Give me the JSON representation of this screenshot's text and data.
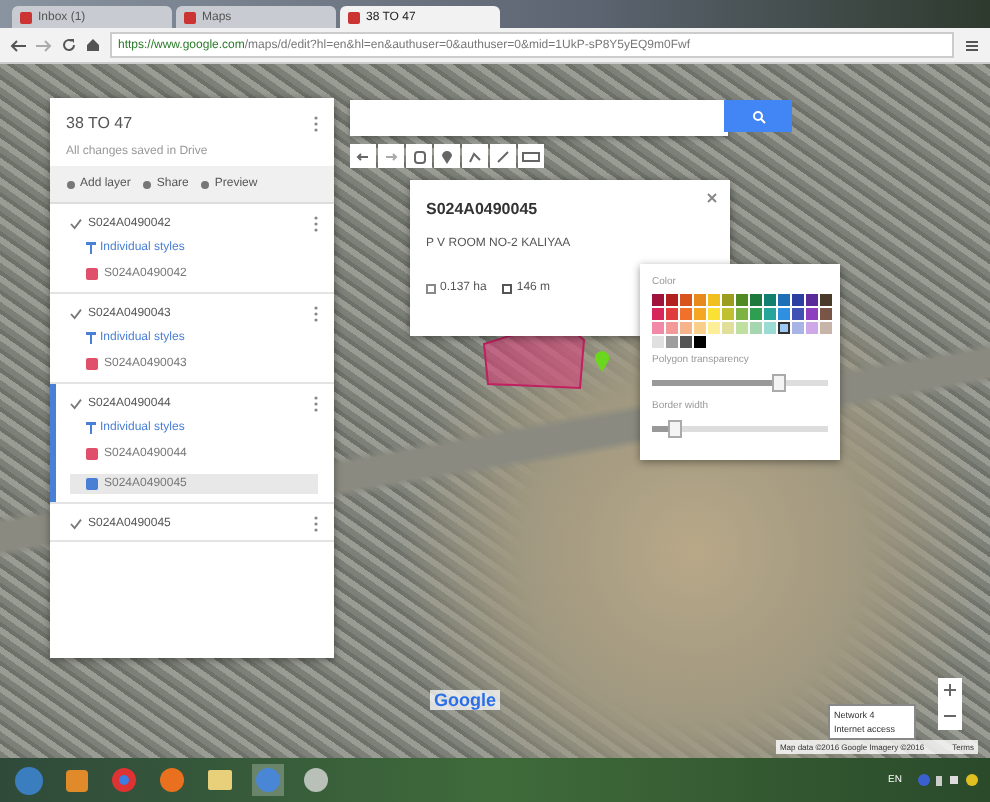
{
  "browser": {
    "tabs": [
      {
        "label": "Inbox (1)",
        "selected": false
      },
      {
        "label": "Maps",
        "selected": false
      },
      {
        "label": "38 TO 47",
        "selected": true
      }
    ],
    "url_host": "https://www.google.com",
    "url_path": "/maps/d/edit?hl=en&hl=en&authuser=0&authuser=0&mid=1UkP-sP8Y5yEQ9m0Fwf"
  },
  "map_panel": {
    "title": "38 TO 47",
    "status": "All changes saved in Drive",
    "actions": [
      "Add layer",
      "Share",
      "Preview"
    ],
    "layers": [
      {
        "name": "S024A0490042",
        "checked": true,
        "selected": false,
        "style": "Individual styles",
        "features": [
          {
            "name": "S024A0490042",
            "color": "#e0506a",
            "selected": false
          }
        ]
      },
      {
        "name": "S024A0490043",
        "checked": true,
        "selected": false,
        "style": "Individual styles",
        "features": [
          {
            "name": "S024A0490043",
            "color": "#e0506a",
            "selected": false
          }
        ]
      },
      {
        "name": "S024A0490044",
        "checked": true,
        "selected": true,
        "style": "Individual styles",
        "features": [
          {
            "name": "S024A0490044",
            "color": "#e0506a",
            "selected": false
          },
          {
            "name": "S024A0490045",
            "color": "#4a7fd6",
            "selected": true
          }
        ]
      },
      {
        "name": "S024A0490045",
        "checked": true,
        "selected": false
      }
    ]
  },
  "feature_popup": {
    "title": "S024A0490045",
    "description": "P V ROOM NO-2 KALIYAA",
    "area": "0.137 ha",
    "perimeter": "146 m"
  },
  "style_picker": {
    "color_label": "Color",
    "swatches": [
      {
        "color": "#a0143c",
        "selected": false
      },
      {
        "color": "#b32020",
        "selected": false
      },
      {
        "color": "#d9531e",
        "selected": false
      },
      {
        "color": "#e8891e",
        "selected": false
      },
      {
        "color": "#f2c01e",
        "selected": false
      },
      {
        "color": "#9c9c1e",
        "selected": false
      },
      {
        "color": "#4f8a22",
        "selected": false
      },
      {
        "color": "#1e7a3c",
        "selected": false
      },
      {
        "color": "#12806e",
        "selected": false
      },
      {
        "color": "#1e6fb8",
        "selected": false
      },
      {
        "color": "#2a3fa0",
        "selected": false
      },
      {
        "color": "#5a2a9a",
        "selected": false
      },
      {
        "color": "#4a3a2a",
        "selected": false
      },
      {
        "color": "#d6265a",
        "selected": false
      },
      {
        "color": "#e03c3c",
        "selected": false
      },
      {
        "color": "#f2702a",
        "selected": false
      },
      {
        "color": "#f5a623",
        "selected": false
      },
      {
        "color": "#fbe134",
        "selected": false
      },
      {
        "color": "#c0c030",
        "selected": false
      },
      {
        "color": "#7cb342",
        "selected": false
      },
      {
        "color": "#2e9e50",
        "selected": false
      },
      {
        "color": "#26a69a",
        "selected": false
      },
      {
        "color": "#2f8fe0",
        "selected": false
      },
      {
        "color": "#3f51b5",
        "selected": false
      },
      {
        "color": "#8e3fc0",
        "selected": false
      },
      {
        "color": "#795548",
        "selected": false
      },
      {
        "color": "#f08aa8",
        "selected": false
      },
      {
        "color": "#f29a9a",
        "selected": false
      },
      {
        "color": "#f7b38a",
        "selected": false
      },
      {
        "color": "#f9d08a",
        "selected": false
      },
      {
        "color": "#fcef98",
        "selected": false
      },
      {
        "color": "#e0e09a",
        "selected": false
      },
      {
        "color": "#bfe0a0",
        "selected": false
      },
      {
        "color": "#a5d6b0",
        "selected": false
      },
      {
        "color": "#9adcd4",
        "selected": false
      },
      {
        "color": "#9cc8f2",
        "selected": true
      },
      {
        "color": "#a8b4e6",
        "selected": false
      },
      {
        "color": "#cfa8e8",
        "selected": false
      },
      {
        "color": "#c8b4a8",
        "selected": false
      },
      {
        "color": "#e0e0e0",
        "selected": false
      },
      {
        "color": "#9e9e9e",
        "selected": false
      },
      {
        "color": "#555555",
        "selected": false
      },
      {
        "color": "#000000",
        "selected": false
      }
    ],
    "transparency_label": "Polygon transparency",
    "transparency": {
      "level": 0.72
    },
    "border_label": "Border width",
    "border": {
      "level": 0.12
    }
  },
  "map_footer": {
    "logo": "Google",
    "attribution": "Map data ©2016 Google Imagery ©2016",
    "terms": "Terms"
  },
  "network_tooltip": {
    "line1": "Network 4",
    "line2": "Internet access"
  },
  "taskbar": {
    "language": "EN"
  }
}
